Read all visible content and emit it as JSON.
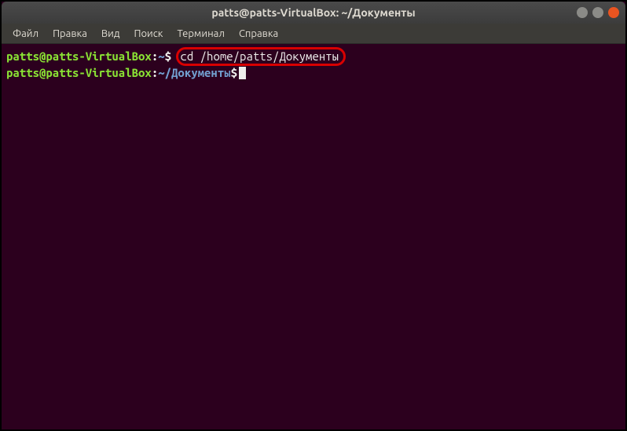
{
  "titlebar": {
    "title": "patts@patts-VirtualBox: ~/Документы"
  },
  "menubar": {
    "items": [
      "Файл",
      "Правка",
      "Вид",
      "Поиск",
      "Терминал",
      "Справка"
    ]
  },
  "terminal": {
    "lines": [
      {
        "user": "patts@patts-VirtualBox",
        "path": "~",
        "command": "cd /home/patts/Документы",
        "highlighted": true
      },
      {
        "user": "patts@patts-VirtualBox",
        "path": "~/Документы",
        "command": "",
        "cursor": true
      }
    ]
  }
}
